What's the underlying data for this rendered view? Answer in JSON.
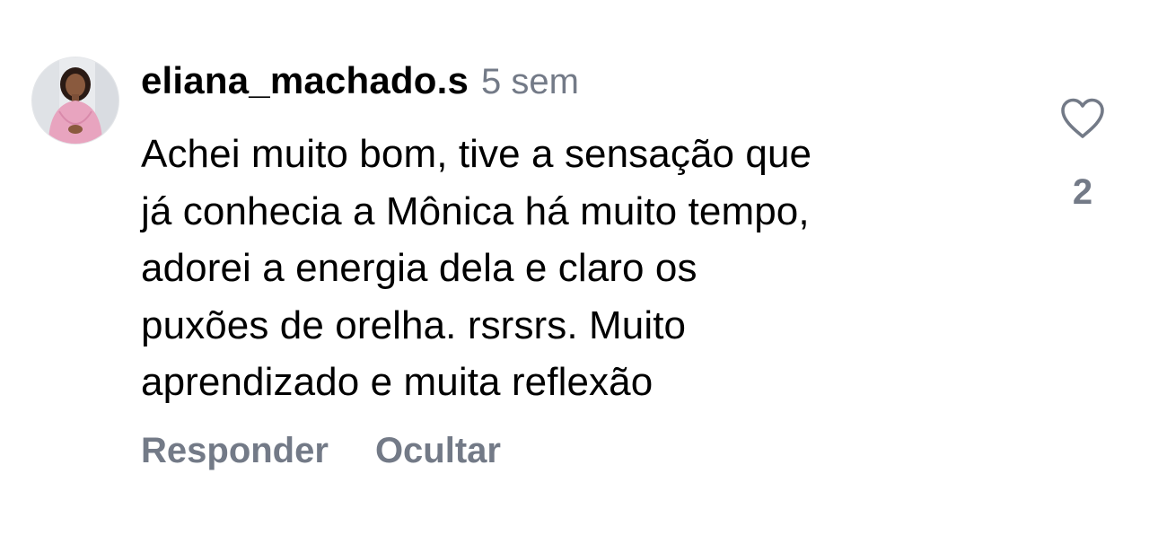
{
  "comment": {
    "username": "eliana_machado.s",
    "timestamp": "5 sem",
    "text": "Achei muito bom, tive a sensação que\njá conhecia a  Mônica há muito tempo,\nadorei a energia dela e claro os\npuxões de orelha. rsrsrs. Muito\naprendizado e muita reflexão",
    "like_count": "2",
    "actions": {
      "reply": "Responder",
      "hide": "Ocultar"
    },
    "icons": {
      "like": "heart-outline-icon",
      "avatar": "user-avatar-photo"
    }
  },
  "colors": {
    "text": "#000000",
    "secondary": "#737a87",
    "background": "#ffffff"
  }
}
